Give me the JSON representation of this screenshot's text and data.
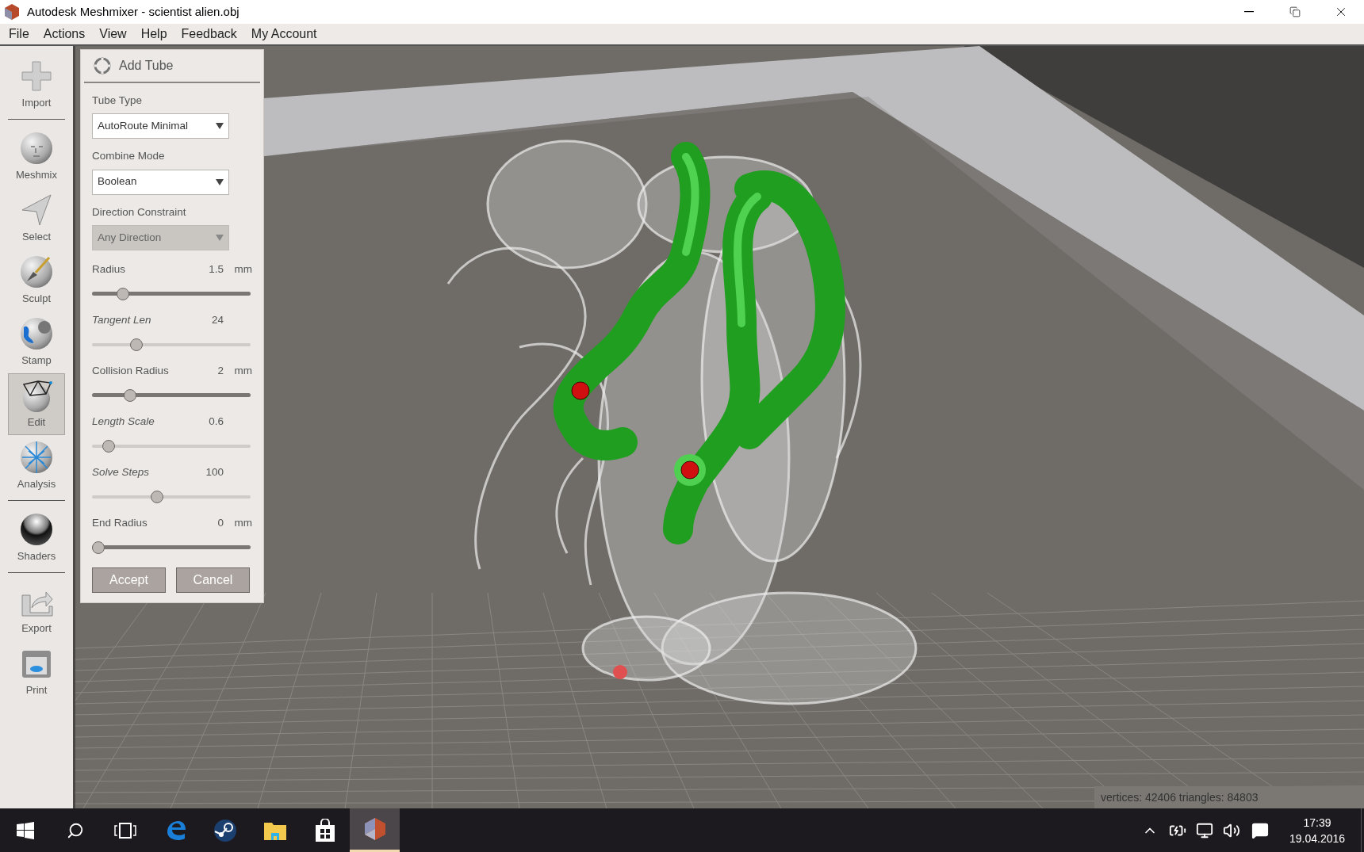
{
  "window": {
    "title": "Autodesk Meshmixer - scientist alien.obj"
  },
  "menu": [
    "File",
    "Actions",
    "View",
    "Help",
    "Feedback",
    "My Account"
  ],
  "toolbar": {
    "groups": [
      {
        "items": [
          {
            "label": "Import",
            "selected": false
          }
        ]
      },
      {
        "items": [
          {
            "label": "Meshmix",
            "selected": false
          },
          {
            "label": "Select",
            "selected": false
          },
          {
            "label": "Sculpt",
            "selected": false
          },
          {
            "label": "Stamp",
            "selected": false
          },
          {
            "label": "Edit",
            "selected": true
          },
          {
            "label": "Analysis",
            "selected": false
          }
        ]
      },
      {
        "items": [
          {
            "label": "Shaders",
            "selected": false
          }
        ]
      },
      {
        "items": [
          {
            "label": "Export",
            "selected": false
          },
          {
            "label": "Print",
            "selected": false
          }
        ]
      }
    ]
  },
  "panel": {
    "title": "Add Tube",
    "dropdowns": [
      {
        "label": "Tube Type",
        "value": "AutoRoute Minimal",
        "disabled": false
      },
      {
        "label": "Combine Mode",
        "value": "Boolean",
        "disabled": false
      },
      {
        "label": "Direction Constraint",
        "value": "Any Direction",
        "disabled": true
      }
    ],
    "sliders": [
      {
        "label": "Radius",
        "kind": "basic",
        "reading": "1.5",
        "unit": "mm",
        "level": 0.17
      },
      {
        "label": "Tangent Len",
        "kind": "advanced",
        "reading": "24",
        "level": 0.26
      },
      {
        "label": "Collision Radius",
        "kind": "basic",
        "reading": "2",
        "unit": "mm",
        "level": 0.22
      },
      {
        "label": "Length Scale",
        "kind": "advanced",
        "reading": "0.6",
        "level": 0.07
      },
      {
        "label": "Solve Steps",
        "kind": "advanced",
        "reading": "100",
        "level": 0.4
      },
      {
        "label": "End Radius",
        "kind": "basic",
        "reading": "0",
        "unit": "mm",
        "level": 0
      }
    ],
    "buttons": [
      "Accept",
      "Cancel"
    ]
  },
  "status_bar": {
    "text": "vertices: 42406 triangles: 84803"
  },
  "taskbar": {
    "time": "17:39",
    "date": "19.04.2016"
  }
}
